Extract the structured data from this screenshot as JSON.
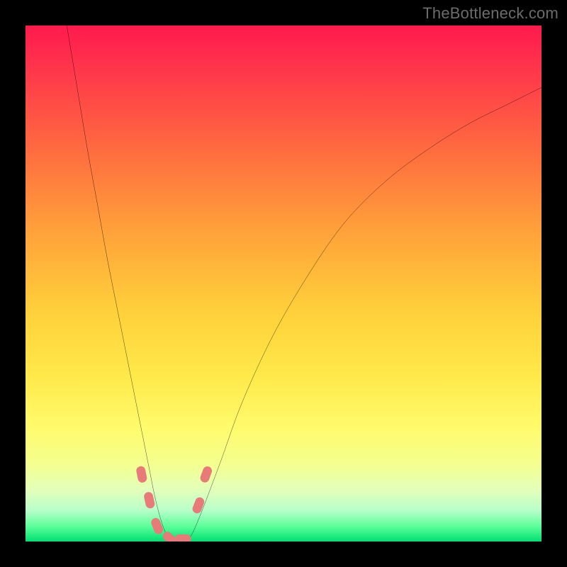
{
  "watermark": "TheBottleneck.com",
  "chart_data": {
    "type": "line",
    "title": "",
    "xlabel": "",
    "ylabel": "",
    "xlim": [
      0,
      100
    ],
    "ylim": [
      0,
      100
    ],
    "grid": false,
    "legend": false,
    "background_gradient_stops": [
      {
        "pos": 0,
        "color": "#ff1a4d"
      },
      {
        "pos": 10,
        "color": "#ff3b4a"
      },
      {
        "pos": 25,
        "color": "#ff6e3f"
      },
      {
        "pos": 40,
        "color": "#ffa23a"
      },
      {
        "pos": 55,
        "color": "#ffcf3a"
      },
      {
        "pos": 68,
        "color": "#ffe94a"
      },
      {
        "pos": 78,
        "color": "#fffb6c"
      },
      {
        "pos": 85,
        "color": "#f4ff8f"
      },
      {
        "pos": 90,
        "color": "#e3ffba"
      },
      {
        "pos": 94,
        "color": "#b7ffca"
      },
      {
        "pos": 97,
        "color": "#5eff9a"
      },
      {
        "pos": 100,
        "color": "#00e070"
      }
    ],
    "series": [
      {
        "name": "bottleneck-curve",
        "color": "#000000",
        "x": [
          8,
          10,
          12,
          14,
          16,
          18,
          20,
          22,
          24,
          25,
          26,
          27,
          28,
          29,
          30,
          31,
          32,
          33,
          35,
          38,
          42,
          48,
          55,
          62,
          70,
          78,
          86,
          94,
          100
        ],
        "y": [
          100,
          88,
          76,
          65,
          54,
          44,
          34,
          24,
          14,
          9,
          5,
          2,
          0,
          0,
          0,
          0,
          1,
          3,
          8,
          16,
          27,
          40,
          52,
          62,
          70,
          76,
          81,
          85,
          88
        ]
      }
    ],
    "markers": [
      {
        "name": "marker-1",
        "x": 22.5,
        "y": 13,
        "size": 3.2,
        "color": "#e97a7a"
      },
      {
        "name": "marker-2",
        "x": 24.0,
        "y": 8,
        "size": 3.2,
        "color": "#e97a7a"
      },
      {
        "name": "marker-3",
        "x": 25.5,
        "y": 3,
        "size": 3.2,
        "color": "#e97a7a"
      },
      {
        "name": "marker-4",
        "x": 28.0,
        "y": 0.5,
        "size": 3.2,
        "color": "#e97a7a"
      },
      {
        "name": "marker-5",
        "x": 30.5,
        "y": 0.5,
        "size": 3.2,
        "color": "#e97a7a"
      },
      {
        "name": "marker-6",
        "x": 33.5,
        "y": 7,
        "size": 3.2,
        "color": "#e97a7a"
      },
      {
        "name": "marker-7",
        "x": 35.0,
        "y": 13,
        "size": 3.2,
        "color": "#e97a7a"
      }
    ]
  }
}
